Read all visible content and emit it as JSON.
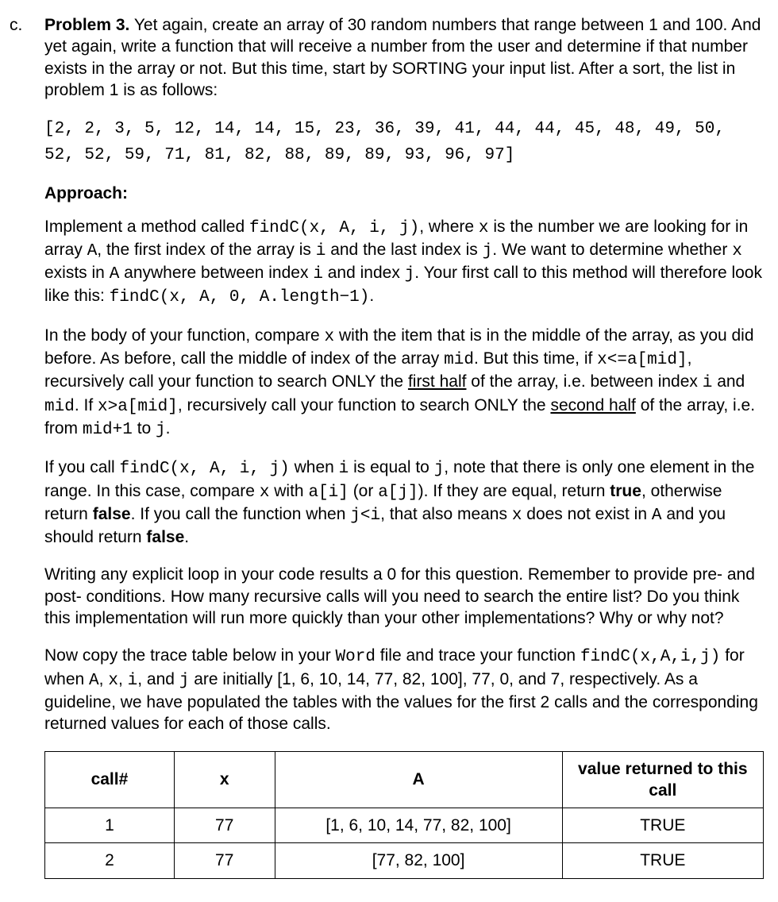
{
  "letter": "c.",
  "title": "Problem 3.",
  "intro_rest": " Yet again, create an array of 30 random numbers that range between 1 and 100. And yet again, write a function that will receive a number from the user and determine if that number exists in the array or not.  But this time, start by SORTING your input list.  After a sort, the list in problem 1 is as follows:",
  "array_block": "[2, 2, 3, 5, 12, 14, 14, 15, 23, 36, 39, 41, 44, 44, 45, 48, 49, 50, 52, 52, 59, 71, 81, 82, 88, 89, 89, 93, 96, 97]",
  "approach_label": "Approach:",
  "p1a": "Implement a method called ",
  "p1_code1": "findC(x, A, i, j)",
  "p1b": ",  where ",
  "p1_code2": "x",
  "p1c": " is the number we are looking for in array ",
  "p1_code3": "A",
  "p1d": ", the first index of the array is ",
  "p1_code4": "i",
  "p1e": " and the last index is ",
  "p1_code5": "j",
  "p1f": ". We want to determine whether ",
  "p1_code6": "x",
  "p1g": " exists in ",
  "p1_code7": "A",
  "p1h": " anywhere between index ",
  "p1_code8": "i",
  "p1i": " and index ",
  "p1_code9": "j",
  "p1j": ". Your first call to this method will therefore look like this: ",
  "p1_code10": "findC(x, A, 0, A.length−1)",
  "p1k": ".",
  "p2a": "In the body of your function, compare ",
  "p2_code1": "x",
  "p2b": " with the item that is in the middle of the array, as you did before.  As before, call the middle of index of the array ",
  "p2_code2": "mid",
  "p2c": ".  But this time, if ",
  "p2_code3": "x<=a[mid]",
  "p2d": ", recursively call your function to search ONLY the ",
  "p2_u1": "first half",
  "p2e": " of the array, i.e. between index ",
  "p2_code4": "i",
  "p2f": " and ",
  "p2_code5": "mid",
  "p2g": ". If ",
  "p2_code6": "x>a[mid]",
  "p2h": ", recursively call your function to search ONLY the ",
  "p2_u2": "second half",
  "p2i": " of the array, i.e. from ",
  "p2_code7": "mid+1",
  "p2j": " to ",
  "p2_code8": "j",
  "p2k": ".",
  "p3a": "If you call  ",
  "p3_code1": "findC(x, A, i, j)",
  "p3b": " when ",
  "p3_code2": "i",
  "p3c": " is equal to ",
  "p3_code3": "j",
  "p3d": ", note that there is only one element in the range. In this case, compare ",
  "p3_code4": "x",
  "p3e": " with ",
  "p3_code5": "a[i]",
  "p3f": "  (or ",
  "p3_code6": "a[j]",
  "p3g": "). If they are equal, return ",
  "p3_b1": "true",
  "p3h": ", otherwise return ",
  "p3_b2": "false",
  "p3i": ". If you call the function when ",
  "p3_code7": "j<i",
  "p3j": ", that also means ",
  "p3_code8": "x",
  "p3k": "  does not exist in ",
  "p3_code9": "A",
  "p3l": " and you should return ",
  "p3_b3": "false",
  "p3m": ".",
  "p4": "Writing any explicit loop in your code results a 0 for this question. Remember to provide pre- and post- conditions. How many recursive calls will you need to search the entire list?  Do you think this implementation will run more quickly than your other implementations?  Why or why not?",
  "p5a": "Now copy the trace table below in your ",
  "p5_code1": "Word",
  "p5b": "  file and trace your function ",
  "p5_code2": "findC(x,A,i,j)",
  "p5c": " for when  ",
  "p5_code3": "A",
  "p5d": ",  ",
  "p5_code4": "x",
  "p5e": ", ",
  "p5_code5": "i",
  "p5f": ", and ",
  "p5_code6": "j",
  "p5g": " are initially [1, 6, 10, 14, 77, 82, 100], 77, 0, and 7, respectively. As a guideline, we have populated the tables with the values for the first 2 calls and the corresponding returned values for each of those calls.",
  "table": {
    "headers": {
      "c1": "call#",
      "c2": "x",
      "c3": "A",
      "c4": "value returned to this call"
    },
    "rows": [
      {
        "c1": "1",
        "c2": "77",
        "c3": "[1, 6, 10, 14, 77, 82, 100]",
        "c4": "TRUE"
      },
      {
        "c1": "2",
        "c2": "77",
        "c3": "[77, 82, 100]",
        "c4": "TRUE"
      }
    ]
  }
}
